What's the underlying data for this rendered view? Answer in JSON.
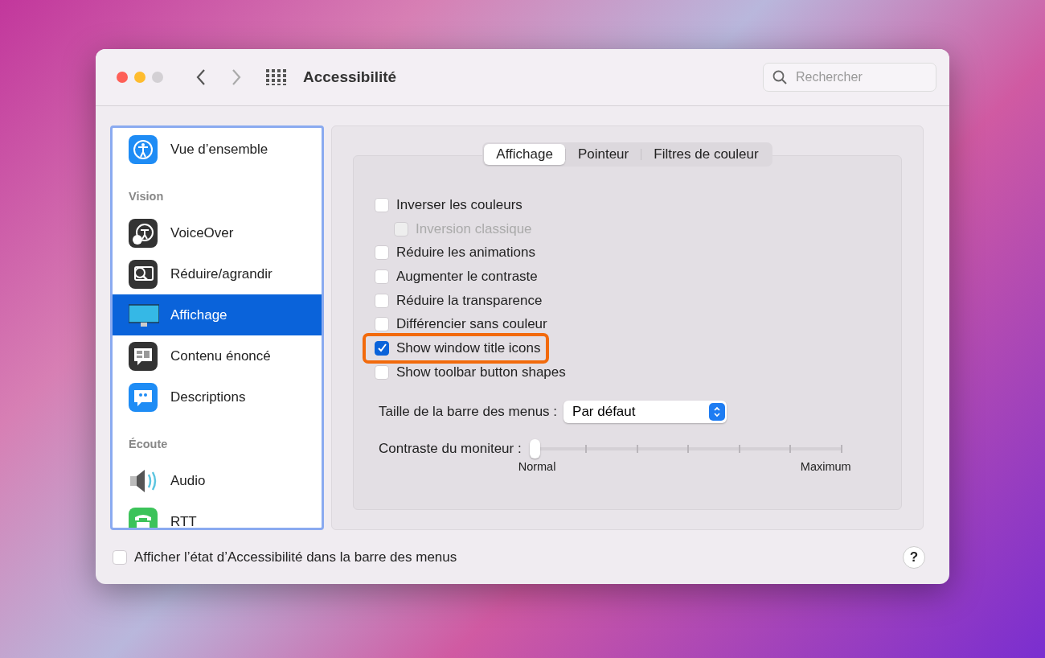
{
  "window": {
    "title": "Accessibilité"
  },
  "search": {
    "placeholder": "Rechercher"
  },
  "sidebar": {
    "items": [
      {
        "kind": "item",
        "label": "Vue d’ensemble",
        "selected": false
      },
      {
        "kind": "header",
        "label": "Vision"
      },
      {
        "kind": "item",
        "label": "VoiceOver",
        "selected": false
      },
      {
        "kind": "item",
        "label": "Réduire/agrandir",
        "selected": false
      },
      {
        "kind": "item",
        "label": "Affichage",
        "selected": true
      },
      {
        "kind": "item",
        "label": "Contenu énoncé",
        "selected": false
      },
      {
        "kind": "item",
        "label": "Descriptions",
        "selected": false
      },
      {
        "kind": "header",
        "label": "Écoute"
      },
      {
        "kind": "item",
        "label": "Audio",
        "selected": false
      },
      {
        "kind": "item",
        "label": "RTT",
        "selected": false
      }
    ]
  },
  "tabs": [
    {
      "label": "Affichage",
      "selected": true
    },
    {
      "label": "Pointeur",
      "selected": false
    },
    {
      "label": "Filtres de couleur",
      "selected": false
    }
  ],
  "options": [
    {
      "label": "Inverser les couleurs",
      "checked": false,
      "disabled": false,
      "children": [
        {
          "label": "Inversion classique",
          "checked": false,
          "disabled": true
        }
      ]
    },
    {
      "label": "Réduire les animations",
      "checked": false,
      "disabled": false
    },
    {
      "label": "Augmenter le contraste",
      "checked": false,
      "disabled": false
    },
    {
      "label": "Réduire la transparence",
      "checked": false,
      "disabled": false
    },
    {
      "label": "Différencier sans couleur",
      "checked": false,
      "disabled": false
    },
    {
      "label": "Show window title icons",
      "checked": true,
      "disabled": false,
      "highlighted": true
    },
    {
      "label": "Show toolbar button shapes",
      "checked": false,
      "disabled": false
    }
  ],
  "menu_bar_size": {
    "label": "Taille de la barre des menus :",
    "value": "Par défaut"
  },
  "contrast": {
    "label": "Contraste du moniteur :",
    "level": 0,
    "min_label": "Normal",
    "max_label": "Maximum"
  },
  "footer": {
    "label": "Afficher l’état d’Accessibilité dans la barre des menus",
    "checked": false,
    "help": "?"
  }
}
